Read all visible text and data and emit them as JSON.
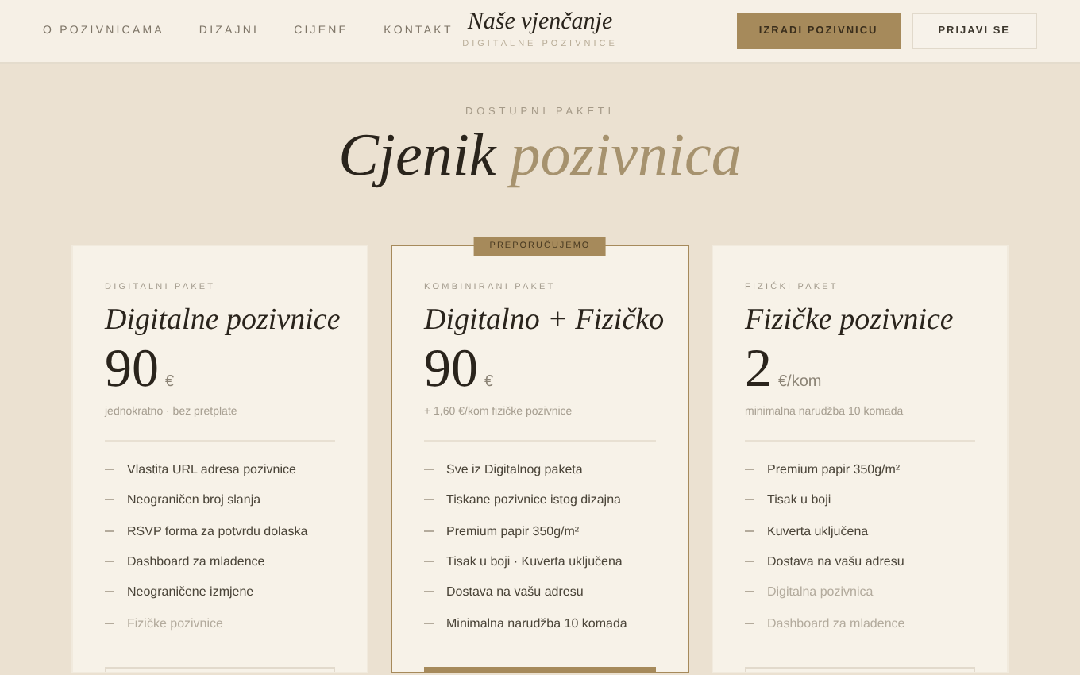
{
  "nav": {
    "links": [
      "O POZIVNICAMA",
      "DIZAJNI",
      "CIJENE",
      "KONTAKT"
    ],
    "logo": "Naše vjenčanje",
    "logo_sub": "DIGITALNE POZIVNICE",
    "buttons": [
      {
        "label": "IZRADI POZIVNICU",
        "kind": "primary"
      },
      {
        "label": "PRIJAVI SE",
        "kind": "outline"
      }
    ]
  },
  "section": {
    "eyebrow": "DOSTUPNI PAKETI",
    "title_main": "Cjenik",
    "title_accent": "pozivnica"
  },
  "plans": [
    {
      "eyebrow": "DIGITALNI PAKET",
      "name": "Digitalne pozivnice",
      "price": "90",
      "unit": "€",
      "note": "jednokratno · bez pretplate",
      "featured": false,
      "features": [
        {
          "text": "Vlastita URL adresa pozivnice",
          "included": true
        },
        {
          "text": "Neograničen broj slanja",
          "included": true
        },
        {
          "text": "RSVP forma za potvrdu dolaska",
          "included": true
        },
        {
          "text": "Dashboard za mladence",
          "included": true
        },
        {
          "text": "Neograničene izmjene",
          "included": true
        },
        {
          "text": "Fizičke pozivnice",
          "included": false
        }
      ]
    },
    {
      "eyebrow": "KOMBINIRANI PAKET",
      "name": "Digitalno + Fizičko",
      "price": "90",
      "unit": "€",
      "note": "+ 1,60 €/kom fizičke pozivnice",
      "featured": true,
      "badge": "PREPORUČUJEMO",
      "features": [
        {
          "text": "Sve iz Digitalnog paketa",
          "included": true
        },
        {
          "text": "Tiskane pozivnice istog dizajna",
          "included": true
        },
        {
          "text": "Premium papir 350g/m²",
          "included": true
        },
        {
          "text": "Tisak u boji · Kuverta uključena",
          "included": true
        },
        {
          "text": "Dostava na vašu adresu",
          "included": true
        },
        {
          "text": "Minimalna narudžba 10 komada",
          "included": true
        }
      ]
    },
    {
      "eyebrow": "FIZIČKI PAKET",
      "name": "Fizičke pozivnice",
      "price": "2",
      "unit": "€/kom",
      "note": "minimalna narudžba 10 komada",
      "featured": false,
      "features": [
        {
          "text": "Premium papir 350g/m²",
          "included": true
        },
        {
          "text": "Tisak u boji",
          "included": true
        },
        {
          "text": "Kuverta uključena",
          "included": true
        },
        {
          "text": "Dostava na vašu adresu",
          "included": true
        },
        {
          "text": "Digitalna pozivnica",
          "included": false
        },
        {
          "text": "Dashboard za mladence",
          "included": false
        }
      ]
    }
  ]
}
